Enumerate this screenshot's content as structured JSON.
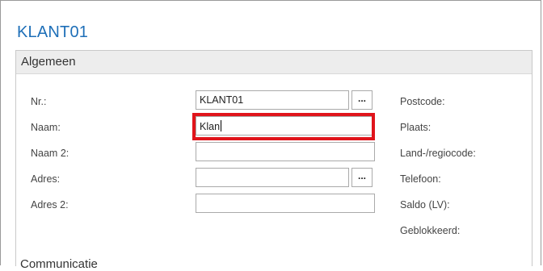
{
  "page": {
    "title": "KLANT01"
  },
  "section": {
    "title": "Algemeen",
    "next_title": "Communicatie",
    "left_fields": [
      {
        "label": "Nr.:",
        "value": "KLANT01",
        "has_lookup": true
      },
      {
        "label": "Naam:",
        "value": "Klan",
        "focused": true
      },
      {
        "label": "Naam 2:",
        "value": ""
      },
      {
        "label": "Adres:",
        "value": "",
        "has_lookup": true
      },
      {
        "label": "Adres 2:",
        "value": ""
      }
    ],
    "lookup_label": "...",
    "right_labels": [
      "Postcode:",
      "Plaats:",
      "Land-/regiocode:",
      "Telefoon:",
      "Saldo (LV):",
      "Geblokkeerd:"
    ]
  },
  "colors": {
    "title": "#1e6fb8",
    "highlight": "#e0141b",
    "header_bg": "#ededed"
  }
}
